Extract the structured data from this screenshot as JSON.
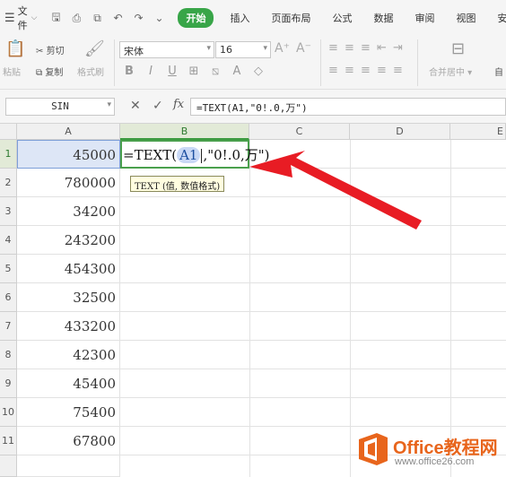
{
  "menubar": {
    "file_label": "文件",
    "tabs": [
      {
        "label": "开始",
        "active": true
      },
      {
        "label": "插入"
      },
      {
        "label": "页面布局"
      },
      {
        "label": "公式"
      },
      {
        "label": "数据"
      },
      {
        "label": "审阅"
      },
      {
        "label": "视图"
      },
      {
        "label": "安全"
      }
    ],
    "accent_color": "#38a548"
  },
  "ribbon": {
    "paste_label": "粘贴",
    "cut_label": "剪切",
    "copy_label": "复制",
    "format_painter_label": "格式刷",
    "font_name": "宋体",
    "font_size": "16",
    "merge_label": "合并居中",
    "auto_wrap_label": "自"
  },
  "formula_bar": {
    "name_box": "SIN",
    "cancel_icon": "✕",
    "confirm_icon": "✓",
    "fx_label": "fx",
    "formula": "=TEXT(A1,\"0!.0,万\")"
  },
  "sheet": {
    "columns": [
      "A",
      "B",
      "C",
      "D",
      "E"
    ],
    "rows": [
      {
        "num": "1",
        "a": "45000"
      },
      {
        "num": "2",
        "a": "780000"
      },
      {
        "num": "3",
        "a": "34200"
      },
      {
        "num": "4",
        "a": "243200"
      },
      {
        "num": "5",
        "a": "454300"
      },
      {
        "num": "6",
        "a": "32500"
      },
      {
        "num": "7",
        "a": "433200"
      },
      {
        "num": "8",
        "a": "42300"
      },
      {
        "num": "9",
        "a": "45400"
      },
      {
        "num": "10",
        "a": "75400"
      },
      {
        "num": "11",
        "a": "67800"
      }
    ],
    "editing_cell": {
      "prefix": "=TEXT(",
      "ref": "A1",
      "suffix": ",\"0!.0,万\")"
    },
    "tooltip": "TEXT (值, 数值格式)"
  },
  "watermark": {
    "title": "Office教程网",
    "url": "www.office26.com"
  }
}
